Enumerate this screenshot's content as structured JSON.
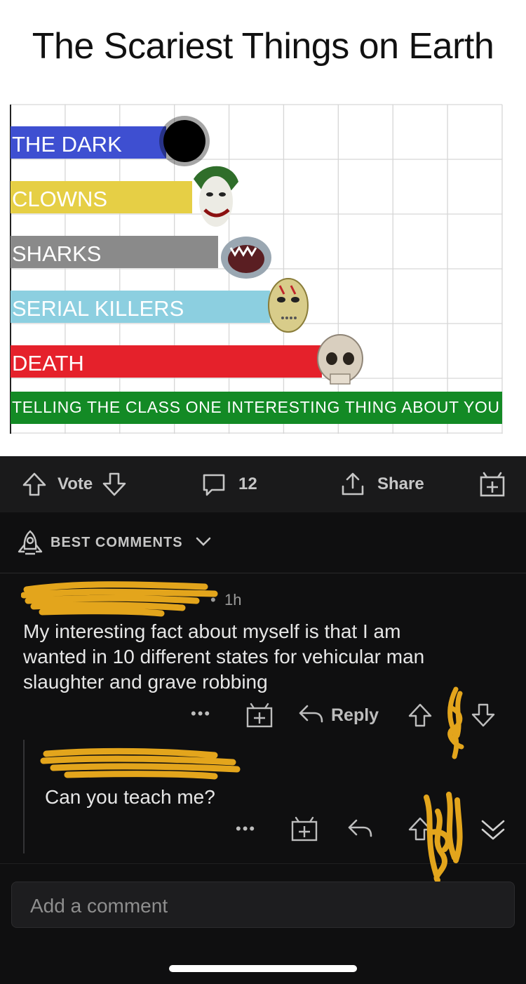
{
  "meme": {
    "title": "The Scariest Things on Earth",
    "bars": [
      {
        "label": "THE DARK",
        "value": 3,
        "color": "#3e4fd1",
        "icon": "darkness-blob-icon"
      },
      {
        "label": "CLOWNS",
        "value": 3.5,
        "color": "#e6cf45",
        "icon": "joker-face-icon"
      },
      {
        "label": "SHARKS",
        "value": 4,
        "color": "#8a8a8a",
        "icon": "shark-icon"
      },
      {
        "label": "SERIAL KILLERS",
        "value": 5,
        "color": "#8ccfe0",
        "icon": "hockey-mask-icon"
      },
      {
        "label": "DEATH",
        "value": 6,
        "color": "#e5212b",
        "icon": "skull-icon"
      },
      {
        "label": "TELLING THE CLASS ONE INTERESTING THING ABOUT YOU",
        "value": 9,
        "color": "#138a25",
        "icon": ""
      }
    ]
  },
  "action_bar": {
    "vote_label": "Vote",
    "comment_count": "12",
    "share_label": "Share"
  },
  "sort": {
    "label": "BEST COMMENTS"
  },
  "comments": [
    {
      "time": "1h",
      "body_lines": [
        "My interesting fact about myself is that I am",
        "wanted in 10 different states for vehicular man",
        "slaughter and grave robbing"
      ],
      "more_label": "•••",
      "reply_label": "Reply"
    },
    {
      "body": "Can you teach me?",
      "more_label": "•••"
    }
  ],
  "composer": {
    "placeholder": "Add a comment"
  },
  "colors": {
    "accent_scribble": "#e3a51c",
    "dark_bg": "#0f0f10",
    "bar_bg": "#1a1a1b"
  }
}
